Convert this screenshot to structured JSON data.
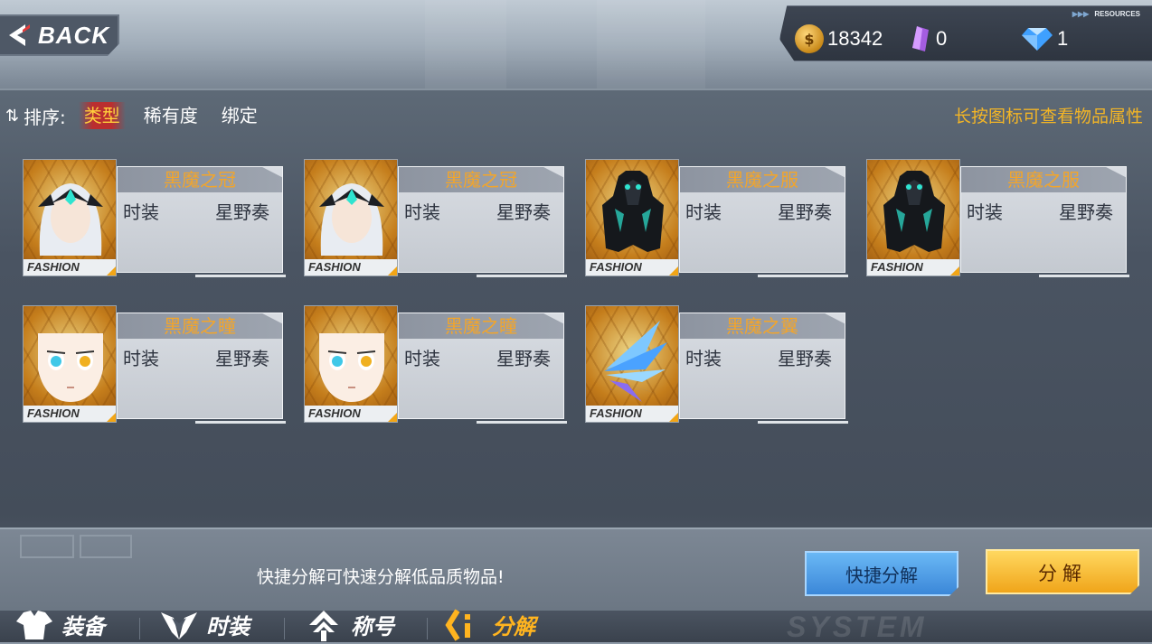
{
  "header": {
    "back_label": "BACK",
    "resources_title": "RESOURCES",
    "gold": "18342",
    "crystal": "0",
    "diamond": "1"
  },
  "sort": {
    "label": "排序:",
    "options": [
      "类型",
      "稀有度",
      "绑定"
    ],
    "active": "类型"
  },
  "hint": "长按图标可查看物品属性",
  "items": [
    {
      "name": "黑魔之冠",
      "type": "时装",
      "owner": "星野奏",
      "tag": "FASHION",
      "icon": "crown-icon"
    },
    {
      "name": "黑魔之冠",
      "type": "时装",
      "owner": "星野奏",
      "tag": "FASHION",
      "icon": "crown-icon"
    },
    {
      "name": "黑魔之服",
      "type": "时装",
      "owner": "星野奏",
      "tag": "FASHION",
      "icon": "armor-icon"
    },
    {
      "name": "黑魔之服",
      "type": "时装",
      "owner": "星野奏",
      "tag": "FASHION",
      "icon": "armor-icon"
    },
    {
      "name": "黑魔之瞳",
      "type": "时装",
      "owner": "星野奏",
      "tag": "FASHION",
      "icon": "eyes-icon"
    },
    {
      "name": "黑魔之瞳",
      "type": "时装",
      "owner": "星野奏",
      "tag": "FASHION",
      "icon": "eyes-icon"
    },
    {
      "name": "黑魔之翼",
      "type": "时装",
      "owner": "星野奏",
      "tag": "FASHION",
      "icon": "wing-icon"
    }
  ],
  "footer": {
    "quick_hint": "快捷分解可快速分解低品质物品!",
    "quick_button": "快捷分解",
    "decompose_button": "分解"
  },
  "tabs": [
    {
      "label": "装备",
      "icon": "shirt-icon"
    },
    {
      "label": "时装",
      "icon": "wing-emblem-icon"
    },
    {
      "label": "称号",
      "icon": "arrow-up-icon"
    },
    {
      "label": "分解",
      "icon": "decompose-icon",
      "active": true
    }
  ],
  "colors": {
    "accent_orange": "#f3a52a",
    "active_tab": "#ffb41f",
    "quick_button": "#3b87d8",
    "decompose_button": "#f0a51a"
  }
}
